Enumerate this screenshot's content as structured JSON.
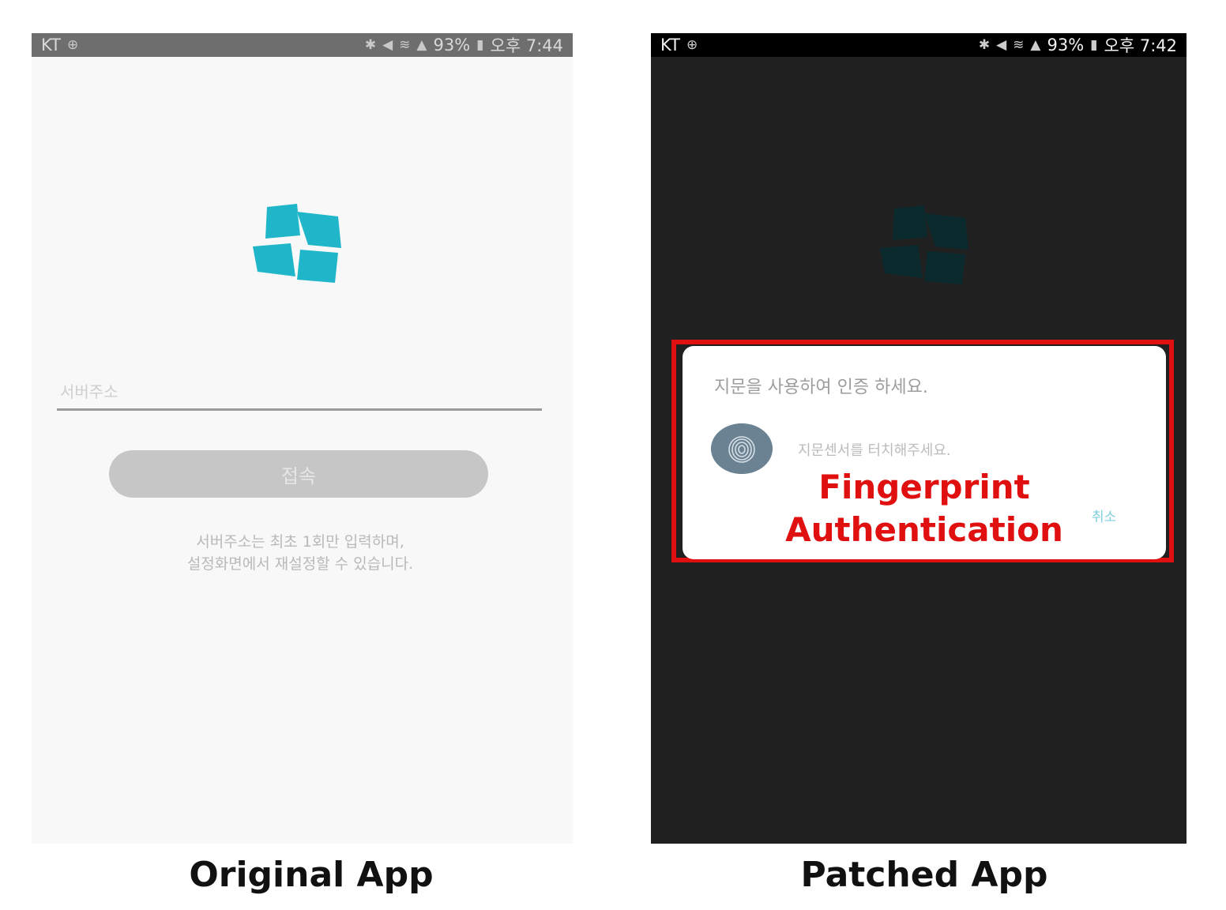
{
  "left_panel": {
    "status_bar": {
      "carrier": "KT",
      "battery": "93%",
      "time": "오후 7:44"
    },
    "server_input": {
      "placeholder": "서버주소"
    },
    "login_button_label": "접속",
    "notice_lines": [
      "서버주소는 최초 1회만 입력하며,",
      "설정화면에서 재설정할 수 있습니다."
    ],
    "brand_color": "#1fb6c9",
    "caption": "Original App"
  },
  "right_panel": {
    "status_bar": {
      "carrier": "KT",
      "battery": "93%",
      "time": "오후 7:42"
    },
    "dialog": {
      "title": "지문을 사용하여 인증 하세요.",
      "hint": "지문센서를 터치해주세요.",
      "cancel_label": "취소"
    },
    "overlay_label_lines": [
      "Fingerprint",
      "Authentication"
    ],
    "highlight_color": "#e01010",
    "caption": "Patched App"
  }
}
